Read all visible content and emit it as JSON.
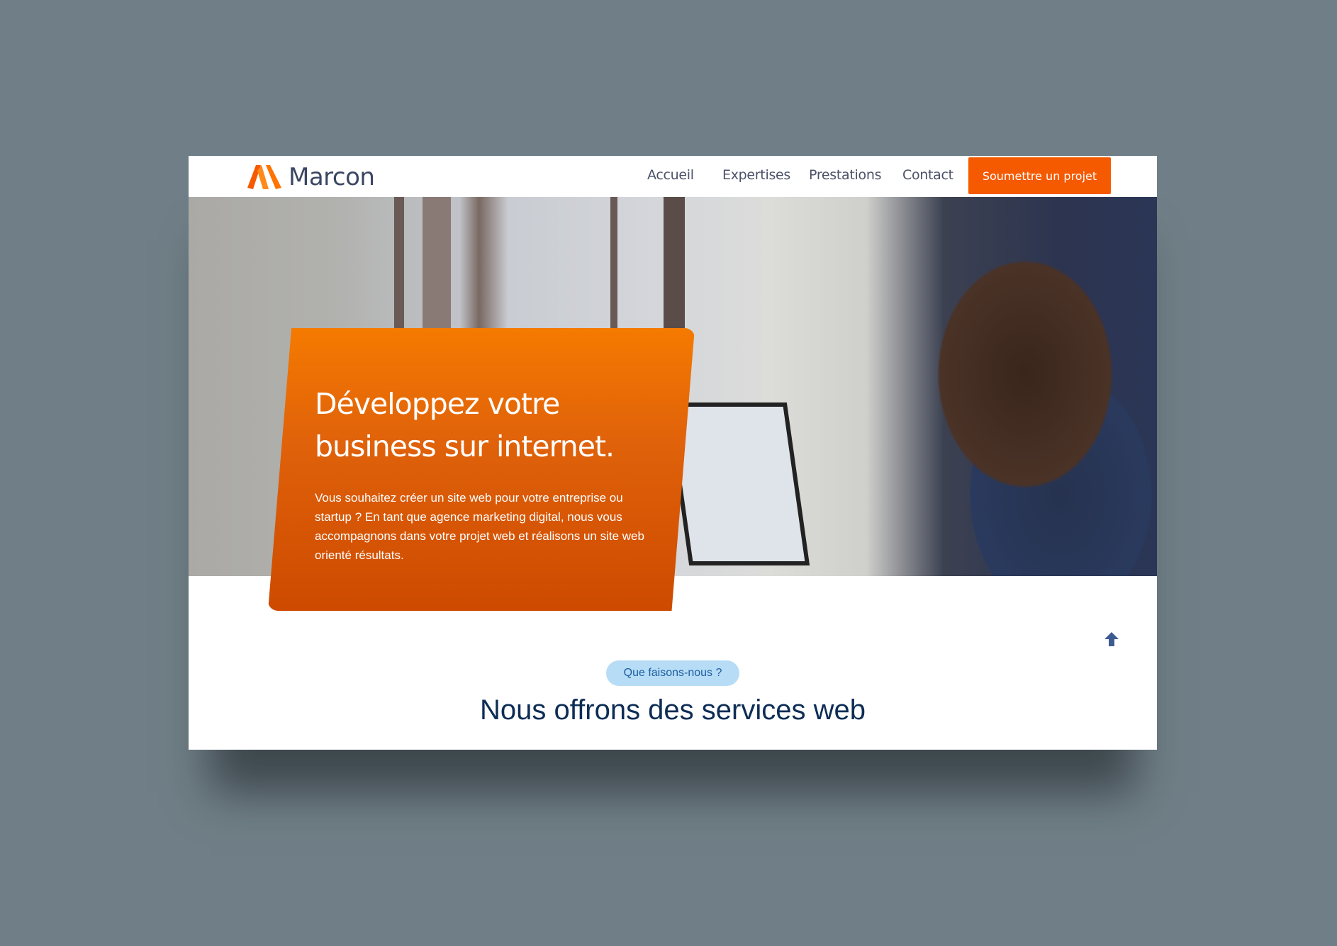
{
  "header": {
    "brand": "Marcon",
    "nav": [
      "Accueil",
      "Expertises",
      "Prestations",
      "Contact"
    ],
    "cta": "Soumettre un projet"
  },
  "hero": {
    "title_line1": "Développez votre",
    "title_line2": "business sur internet.",
    "text": "Vous souhaitez créer un site web pour votre entreprise ou startup ? En tant que agence marketing digital, nous vous accompagnons dans votre projet web et réalisons un site web orienté résultats."
  },
  "section": {
    "badge": "Que faisons-nous ?",
    "title": "Nous offrons des services web"
  },
  "colors": {
    "accent": "#f55a00",
    "title": "#0d2d55",
    "badge_bg": "#b7dcf5"
  },
  "icons": {
    "logo": "marcon-m-logo",
    "scroll": "arrow-up-icon"
  }
}
